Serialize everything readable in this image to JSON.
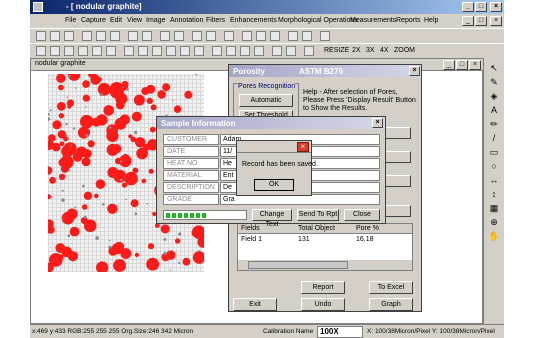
{
  "window": {
    "title": "- [ nodular graphite]",
    "minimize": "_",
    "maximize": "□",
    "close": "×"
  },
  "menu": [
    "File",
    "Capture",
    "Edit",
    "View",
    "Image",
    "Annotation",
    "Filters",
    "Enhancements",
    "Morphological Operations",
    "Measurements",
    "Reports",
    "Help"
  ],
  "toolbar2": {
    "resize": "RESIZE",
    "z2": "2X",
    "z3": "3X",
    "z4": "4X",
    "zoom": "ZOOM"
  },
  "mdi": {
    "tab": "nodular graphite"
  },
  "status": {
    "coords": "x:469 y:433 RGB:255 255 255 Org.Size:246 342 Micron",
    "calibration": "Calibration Name",
    "mag": "100X",
    "pixel": "X: 100/38Micron/Pixel Y: 100/38Micron/Pixel"
  },
  "porosity": {
    "title": "Porosity",
    "subtitle": "ASTM B276",
    "group_title": "Pores Recognition",
    "automatic": "Automatic",
    "set_threshold": "Set Threshold",
    "help_text": "Help - After selection of Pores, Please Press 'Display Result' Button to Show the Results.",
    "table_headers": [
      "Fields",
      "Total Object",
      "Pore %"
    ],
    "table_rows": [
      [
        "Field 1",
        "131",
        "16.18"
      ]
    ],
    "report": "Report",
    "to_excel": "To Excel",
    "exit": "Exit",
    "undo": "Undo",
    "graph": "Graph"
  },
  "sample": {
    "title": "Sample Information",
    "labels": [
      "CUSTOMER",
      "DATE",
      "HEAT NO",
      "MATERIAL",
      "DESCRIPTION",
      "GRADE"
    ],
    "values": [
      "Adam",
      "11/",
      "He",
      "Ent",
      "De",
      "Gra"
    ],
    "change_text": "Change Text",
    "send_to_rpt": "Send To Rpt",
    "close": "Close",
    "progress": 0.5
  },
  "msgbox": {
    "text": "Record has been saved.",
    "ok": "OK"
  }
}
